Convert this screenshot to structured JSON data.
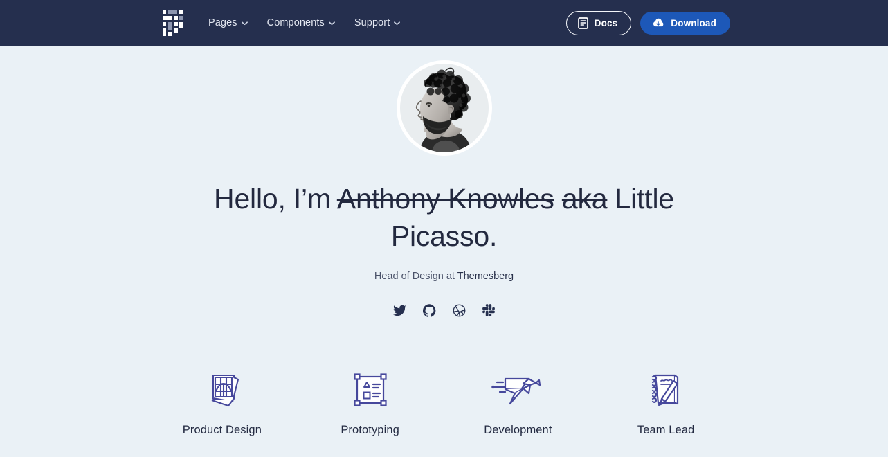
{
  "theme": {
    "navbar_bg": "#252f4e",
    "page_bg": "#eaf1f6",
    "accent_blue": "#1d58b8",
    "heading_color": "#23293f",
    "icon_indigo": "#46489c"
  },
  "navbar": {
    "brand": {
      "name": "pixel-logo",
      "label": "Pixel"
    },
    "links": [
      {
        "label": "Pages",
        "icon": "chevron-down-icon",
        "has_dropdown": true
      },
      {
        "label": "Components",
        "icon": "chevron-down-icon",
        "has_dropdown": true
      },
      {
        "label": "Support",
        "icon": "chevron-down-icon",
        "has_dropdown": true
      }
    ],
    "actions": {
      "docs": {
        "label": "Docs",
        "icon": "book-icon"
      },
      "download": {
        "label": "Download",
        "icon": "cloud-download-icon"
      }
    }
  },
  "hero": {
    "avatar_alt": "portrait-photo",
    "headline": {
      "greeting": "Hello, I’m ",
      "struck_name": "Anthony Knowles",
      "struck_aka": "aka",
      "real_name": " Little Picasso."
    },
    "subtitle": {
      "prefix": "Head of Design at ",
      "link": "Themesberg"
    },
    "socials": [
      {
        "name": "twitter-icon",
        "label": "Twitter"
      },
      {
        "name": "github-icon",
        "label": "GitHub"
      },
      {
        "name": "dribbble-icon",
        "label": "Dribbble"
      },
      {
        "name": "slack-icon",
        "label": "Slack"
      }
    ]
  },
  "features": [
    {
      "label": "Product Design",
      "icon": "photo-frames-icon"
    },
    {
      "label": "Prototyping",
      "icon": "artboard-icon"
    },
    {
      "label": "Development",
      "icon": "paper-bird-icon"
    },
    {
      "label": "Team Lead",
      "icon": "notepad-pencil-icon"
    }
  ]
}
